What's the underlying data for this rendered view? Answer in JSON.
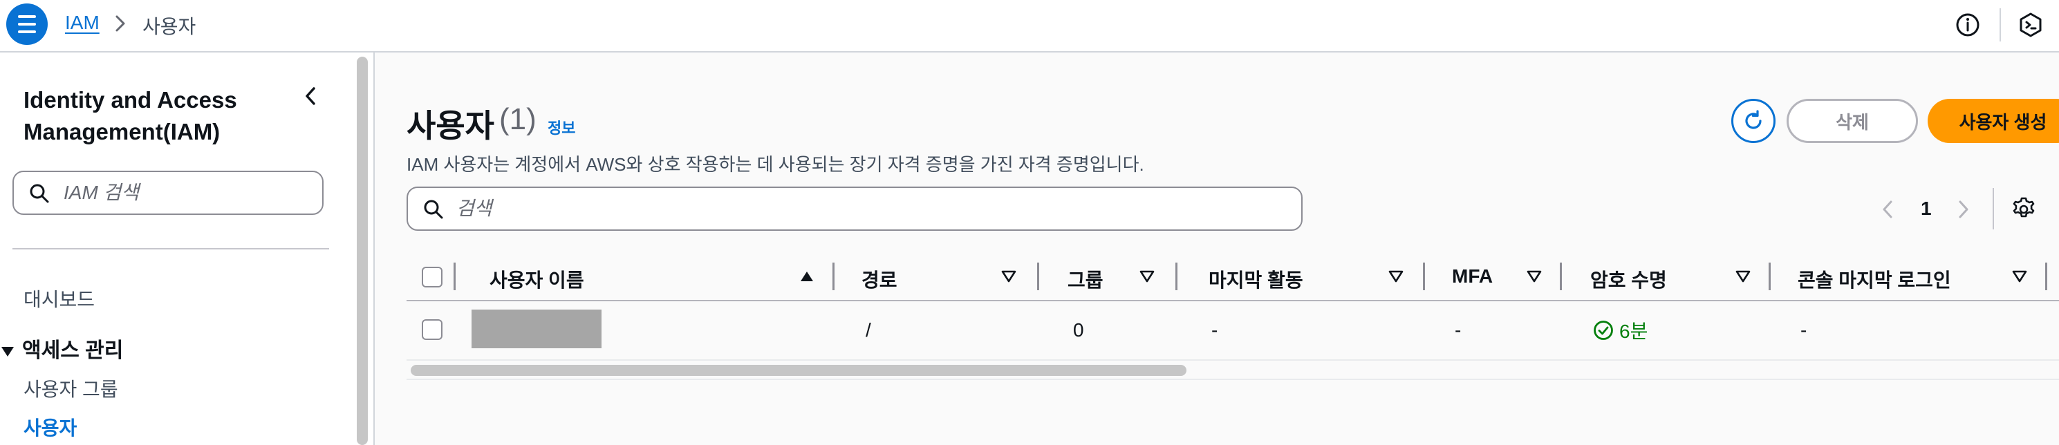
{
  "breadcrumb": {
    "root": "IAM",
    "current": "사용자"
  },
  "sidebar": {
    "title": "Identity and Access Management(IAM)",
    "search_placeholder": "IAM 검색",
    "dashboard": "대시보드",
    "section": "액세스 관리",
    "items": [
      {
        "label": "사용자 그룹"
      },
      {
        "label": "사용자",
        "active": true
      }
    ]
  },
  "main": {
    "title": "사용자",
    "count": "(1)",
    "info": "정보",
    "description": "IAM 사용자는 계정에서 AWS와 상호 작용하는 데 사용되는 장기 자격 증명을 가진 자격 증명입니다.",
    "actions": {
      "delete": "삭제",
      "create": "사용자 생성"
    },
    "search_placeholder": "검색",
    "pagination": {
      "page": "1"
    }
  },
  "table": {
    "columns": [
      "사용자 이름",
      "경로",
      "그룹",
      "마지막 활동",
      "MFA",
      "암호 수명",
      "콘솔 마지막 로그인"
    ],
    "rows": [
      {
        "username": "",
        "path": "/",
        "groups": "0",
        "last_activity": "-",
        "mfa": "-",
        "password_age": "6분",
        "console_last_login": "-"
      }
    ]
  },
  "colors": {
    "accent": "#0972d3",
    "primary_button": "#ff9900",
    "success": "#037f0c"
  },
  "icons": [
    "menu-icon",
    "chevron-right-icon",
    "info-icon",
    "cloudshell-icon",
    "chevron-left-icon",
    "search-icon",
    "refresh-icon",
    "settings-icon",
    "sort-ascending-icon",
    "sort-icon",
    "check-circle-icon"
  ]
}
